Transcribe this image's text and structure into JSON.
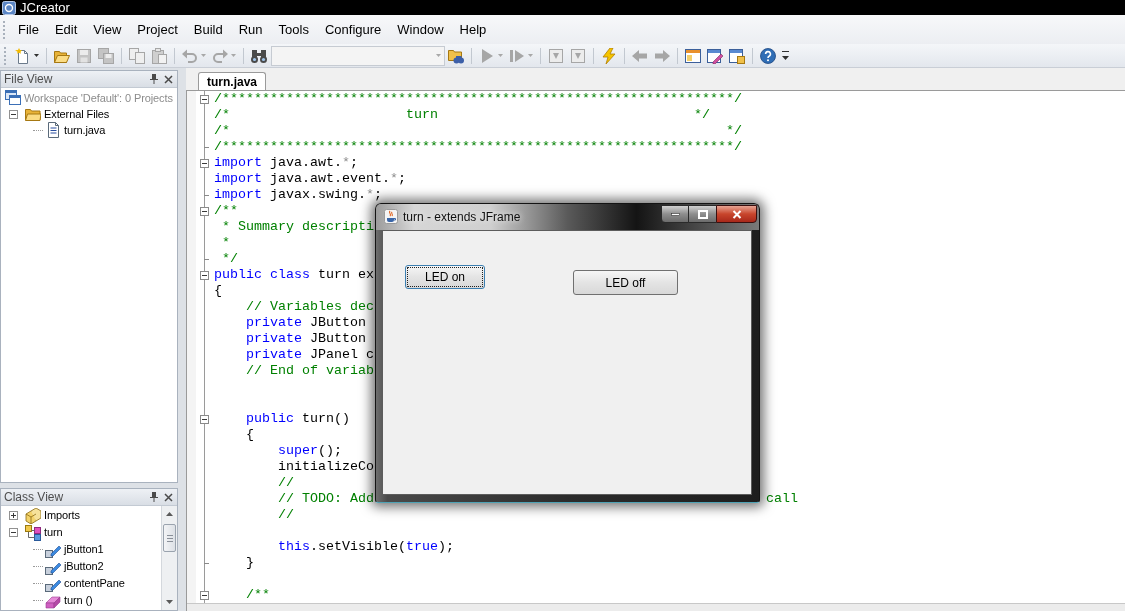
{
  "app": {
    "title": "JCreator"
  },
  "menu": [
    "File",
    "Edit",
    "View",
    "Project",
    "Build",
    "Run",
    "Tools",
    "Configure",
    "Window",
    "Help"
  ],
  "toolbar": [
    {
      "items": [
        {
          "kind": "new",
          "disabled": false,
          "dropdown": true
        }
      ]
    },
    {
      "items": [
        {
          "kind": "open",
          "disabled": false,
          "dropdown": false
        },
        {
          "kind": "save",
          "disabled": true,
          "dropdown": false
        },
        {
          "kind": "save_all",
          "disabled": true,
          "dropdown": false
        }
      ]
    },
    {
      "items": [
        {
          "kind": "copy",
          "disabled": true,
          "dropdown": false
        },
        {
          "kind": "paste",
          "disabled": true,
          "dropdown": false
        }
      ]
    },
    {
      "items": [
        {
          "kind": "undo",
          "disabled": true,
          "dropdown": true
        },
        {
          "kind": "redo",
          "disabled": true,
          "dropdown": true
        }
      ]
    },
    {
      "items": [
        {
          "kind": "find",
          "disabled": false,
          "dropdown": false
        },
        {
          "kind": "combo",
          "disabled": true
        },
        {
          "kind": "find_files",
          "disabled": false,
          "dropdown": false
        }
      ]
    },
    {
      "items": [
        {
          "kind": "run",
          "disabled": true,
          "dropdown": true
        },
        {
          "kind": "step",
          "disabled": true,
          "dropdown": true
        }
      ]
    },
    {
      "items": [
        {
          "kind": "box_down",
          "disabled": true,
          "dropdown": false
        },
        {
          "kind": "box_down",
          "disabled": true,
          "dropdown": false
        }
      ]
    },
    {
      "items": [
        {
          "kind": "lightning",
          "disabled": false,
          "dropdown": false
        }
      ]
    },
    {
      "items": [
        {
          "kind": "back",
          "disabled": true,
          "dropdown": false
        },
        {
          "kind": "forward",
          "disabled": true,
          "dropdown": false
        }
      ]
    },
    {
      "items": [
        {
          "kind": "window_a",
          "disabled": false,
          "dropdown": false
        },
        {
          "kind": "window_b",
          "disabled": false,
          "dropdown": false
        },
        {
          "kind": "window_c",
          "disabled": false,
          "dropdown": false
        }
      ]
    },
    {
      "items": [
        {
          "kind": "help",
          "disabled": false,
          "dropdown": false
        }
      ]
    }
  ],
  "file_view": {
    "title": "File View",
    "tree": [
      {
        "label": "Workspace 'Default': 0 Projects",
        "kind": "workspace",
        "children": [
          {
            "label": "External Files",
            "kind": "folder",
            "expanded": true,
            "children": [
              {
                "label": "turn.java",
                "kind": "java_file"
              }
            ]
          }
        ]
      }
    ]
  },
  "class_view": {
    "title": "Class View",
    "tree": [
      {
        "label": "Imports",
        "kind": "imports",
        "expanded": false
      },
      {
        "label": "turn",
        "kind": "class",
        "expanded": true,
        "children": [
          {
            "label": "jButton1",
            "kind": "field"
          },
          {
            "label": "jButton2",
            "kind": "field"
          },
          {
            "label": "contentPane",
            "kind": "field"
          },
          {
            "label": "turn ()",
            "kind": "method"
          }
        ]
      }
    ]
  },
  "tabs": [
    {
      "label": "turn.java",
      "selected": true
    }
  ],
  "code": [
    {
      "kind": "text",
      "collapsible": true,
      "segments": [
        {
          "kind": "comment",
          "text": "/****************************************************************/"
        }
      ]
    },
    {
      "kind": "text",
      "segments": [
        {
          "kind": "comment",
          "text": "/*                      turn                                */"
        }
      ]
    },
    {
      "kind": "text",
      "segments": [
        {
          "kind": "comment",
          "text": "/*                                                              */"
        }
      ]
    },
    {
      "kind": "text",
      "fold_end": true,
      "segments": [
        {
          "kind": "comment",
          "text": "/****************************************************************/"
        }
      ]
    },
    {
      "kind": "text",
      "collapsible": true,
      "segments": [
        {
          "kind": "keyword",
          "text": "import"
        },
        {
          "kind": "plain",
          "text": " java.awt."
        },
        {
          "kind": "dim",
          "text": "*"
        },
        {
          "kind": "plain",
          "text": ";"
        }
      ]
    },
    {
      "kind": "text",
      "segments": [
        {
          "kind": "keyword",
          "text": "import"
        },
        {
          "kind": "plain",
          "text": " java.awt.event."
        },
        {
          "kind": "dim",
          "text": "*"
        },
        {
          "kind": "plain",
          "text": ";"
        }
      ]
    },
    {
      "kind": "text",
      "fold_end": true,
      "segments": [
        {
          "kind": "keyword",
          "text": "import"
        },
        {
          "kind": "plain",
          "text": " javax.swing."
        },
        {
          "kind": "dim",
          "text": "*"
        },
        {
          "kind": "plain",
          "text": ";"
        }
      ]
    },
    {
      "kind": "text",
      "collapsible": true,
      "segments": [
        {
          "kind": "comment",
          "text": "/**"
        }
      ]
    },
    {
      "kind": "text",
      "segments": [
        {
          "kind": "comment",
          "text": " * Summary descripti"
        }
      ]
    },
    {
      "kind": "text",
      "segments": [
        {
          "kind": "comment",
          "text": " *"
        }
      ]
    },
    {
      "kind": "text",
      "fold_end": true,
      "segments": [
        {
          "kind": "comment",
          "text": " */"
        }
      ]
    },
    {
      "kind": "text",
      "collapsible": true,
      "segments": [
        {
          "kind": "keyword",
          "text": "public"
        },
        {
          "kind": "keyword",
          "text": " class"
        },
        {
          "kind": "plain",
          "text": " turn ex"
        }
      ]
    },
    {
      "kind": "text",
      "segments": [
        {
          "kind": "plain",
          "text": "{"
        }
      ]
    },
    {
      "kind": "text",
      "segments": [
        {
          "kind": "comment",
          "text": "    // Variables dec"
        }
      ]
    },
    {
      "kind": "text",
      "segments": [
        {
          "kind": "keyword",
          "text": "    private"
        },
        {
          "kind": "plain",
          "text": " JButton"
        }
      ]
    },
    {
      "kind": "text",
      "segments": [
        {
          "kind": "keyword",
          "text": "    private"
        },
        {
          "kind": "plain",
          "text": " JButton"
        }
      ]
    },
    {
      "kind": "text",
      "segments": [
        {
          "kind": "keyword",
          "text": "    private"
        },
        {
          "kind": "plain",
          "text": " JPanel c"
        }
      ]
    },
    {
      "kind": "text",
      "segments": [
        {
          "kind": "comment",
          "text": "    // End of variab"
        }
      ]
    },
    {
      "kind": "blank"
    },
    {
      "kind": "blank"
    },
    {
      "kind": "text",
      "collapsible": true,
      "segments": [
        {
          "kind": "keyword",
          "text": "    public"
        },
        {
          "kind": "plain",
          "text": " turn()"
        }
      ]
    },
    {
      "kind": "text",
      "segments": [
        {
          "kind": "plain",
          "text": "    {"
        }
      ]
    },
    {
      "kind": "text",
      "segments": [
        {
          "kind": "keyword",
          "text": "        super"
        },
        {
          "kind": "plain",
          "text": "();"
        }
      ]
    },
    {
      "kind": "text",
      "segments": [
        {
          "kind": "plain",
          "text": "        initializeCo"
        }
      ]
    },
    {
      "kind": "text",
      "segments": [
        {
          "kind": "comment",
          "text": "        //"
        }
      ]
    },
    {
      "kind": "text",
      "segments": [
        {
          "kind": "comment",
          "text": "        // TODO: Add"
        }
      ],
      "tail": [
        {
          "kind": "comment",
          "text": "call"
        }
      ]
    },
    {
      "kind": "text",
      "segments": [
        {
          "kind": "comment",
          "text": "        //"
        }
      ]
    },
    {
      "kind": "blank"
    },
    {
      "kind": "text",
      "segments": [
        {
          "kind": "keyword",
          "text": "        this"
        },
        {
          "kind": "plain",
          "text": ".setVisible("
        },
        {
          "kind": "keyword",
          "text": "true"
        },
        {
          "kind": "plain",
          "text": ");"
        }
      ]
    },
    {
      "kind": "text",
      "fold_end": true,
      "segments": [
        {
          "kind": "plain",
          "text": "    }"
        }
      ]
    },
    {
      "kind": "blank"
    },
    {
      "kind": "text",
      "collapsible": true,
      "segments": [
        {
          "kind": "comment",
          "text": "    /**"
        }
      ]
    }
  ],
  "dialog": {
    "title": "turn - extends JFrame",
    "buttons": [
      {
        "label": "LED on",
        "focused": true
      },
      {
        "label": "LED off",
        "focused": false
      }
    ]
  }
}
